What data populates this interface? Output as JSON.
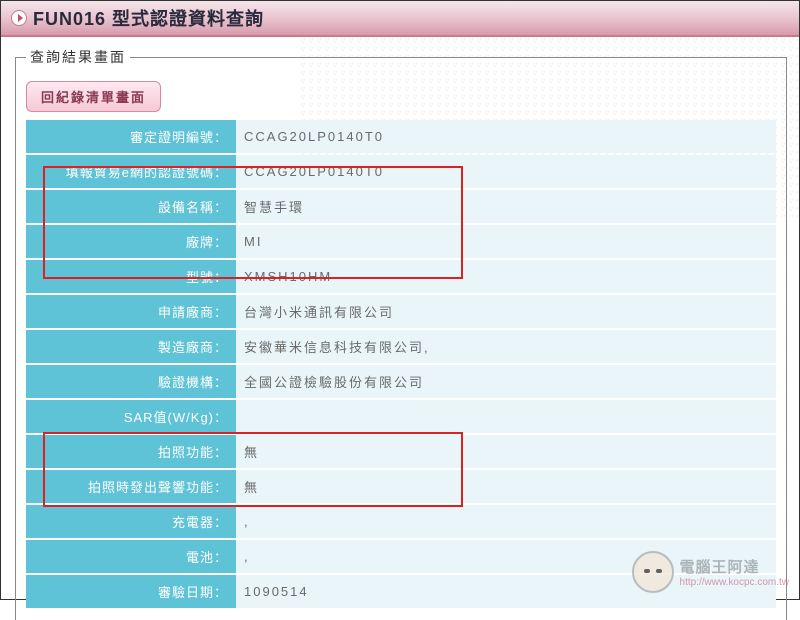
{
  "header": {
    "title": "FUN016 型式認證資料查詢"
  },
  "results": {
    "legend": "查詢結果畫面",
    "back_button": "回紀錄清單畫面",
    "rows": [
      {
        "label": "審定證明編號：",
        "value": "CCAG20LP0140T0"
      },
      {
        "label": "填報貿易e網的認證號碼：",
        "value": "CCAG20LP0140T0"
      },
      {
        "label": "設備名稱：",
        "value": "智慧手環"
      },
      {
        "label": "廠牌：",
        "value": "MI"
      },
      {
        "label": "型號：",
        "value": "XMSH10HM"
      },
      {
        "label": "申請廠商：",
        "value": "台灣小米通訊有限公司"
      },
      {
        "label": "製造廠商：",
        "value": "安徽華米信息科技有限公司,"
      },
      {
        "label": "驗證機構：",
        "value": "全國公證檢驗股份有限公司"
      },
      {
        "label": "SAR值(W/Kg)：",
        "value": ""
      },
      {
        "label": "拍照功能：",
        "value": "無"
      },
      {
        "label": "拍照時發出聲響功能：",
        "value": "無"
      },
      {
        "label": "充電器：",
        "value": ","
      },
      {
        "label": "電池：",
        "value": ","
      },
      {
        "label": "審驗日期：",
        "value": "1090514"
      }
    ]
  },
  "watermark": {
    "main": "電腦王阿達",
    "sub": "http://www.kocpc.com.tw"
  }
}
